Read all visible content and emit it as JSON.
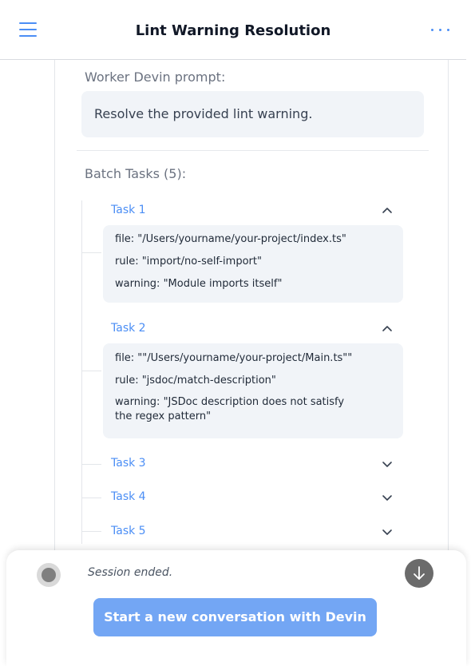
{
  "header": {
    "title": "Lint Warning Resolution",
    "menu_icon": "hamburger-menu-icon",
    "more_icon": "more-dots-icon"
  },
  "prompt": {
    "label": "Worker Devin prompt:",
    "text": "Resolve the provided lint warning."
  },
  "batch": {
    "label": "Batch Tasks (5):",
    "tasks": [
      {
        "title": "Task 1",
        "expanded": true,
        "lines": [
          "file: \"/Users/yourname/your-project/index.ts\"",
          "rule: \"import/no-self-import\"",
          "warning: \"Module imports itself\""
        ]
      },
      {
        "title": "Task 2",
        "expanded": true,
        "lines": [
          "file: \"\"/Users/yourname/your-project/Main.ts\"\"",
          "rule: \"jsdoc/match-description\"",
          "warning: \"JSDoc description does not satisfy",
          "the regex pattern\""
        ]
      },
      {
        "title": "Task 3",
        "expanded": false,
        "lines": []
      },
      {
        "title": "Task 4",
        "expanded": false,
        "lines": []
      },
      {
        "title": "Task 5",
        "expanded": false,
        "lines": []
      }
    ]
  },
  "footer": {
    "status_text": "Session ended.",
    "new_conversation_label": "Start a new conversation with Devin"
  },
  "colors": {
    "accent": "#4b8ef5",
    "button": "#73a6f4",
    "card_bg": "#f1f4f8"
  }
}
